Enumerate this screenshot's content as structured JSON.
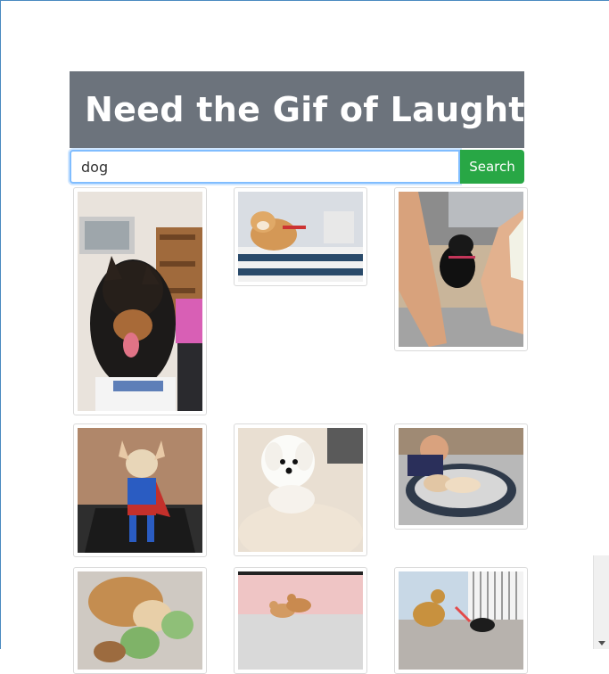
{
  "header": {
    "title": "Need the Gif of Laughter?"
  },
  "search": {
    "value": "dog",
    "button_label": "Search"
  },
  "results": [
    {
      "subject": "german-shepherd-puppy"
    },
    {
      "subject": "shiba-with-laptop"
    },
    {
      "subject": "black-puppy-held"
    },
    {
      "subject": "chihuahua-superman-costume"
    },
    {
      "subject": "white-fluffy-dog-on-rug"
    },
    {
      "subject": "puppy-in-bath-tub"
    },
    {
      "subject": "dog-with-cabbages"
    },
    {
      "subject": "two-puppies-playing"
    },
    {
      "subject": "dog-and-cat-at-door"
    }
  ],
  "colors": {
    "banner": "#6c737c",
    "button": "#28a745",
    "focus": "#80bdff"
  }
}
